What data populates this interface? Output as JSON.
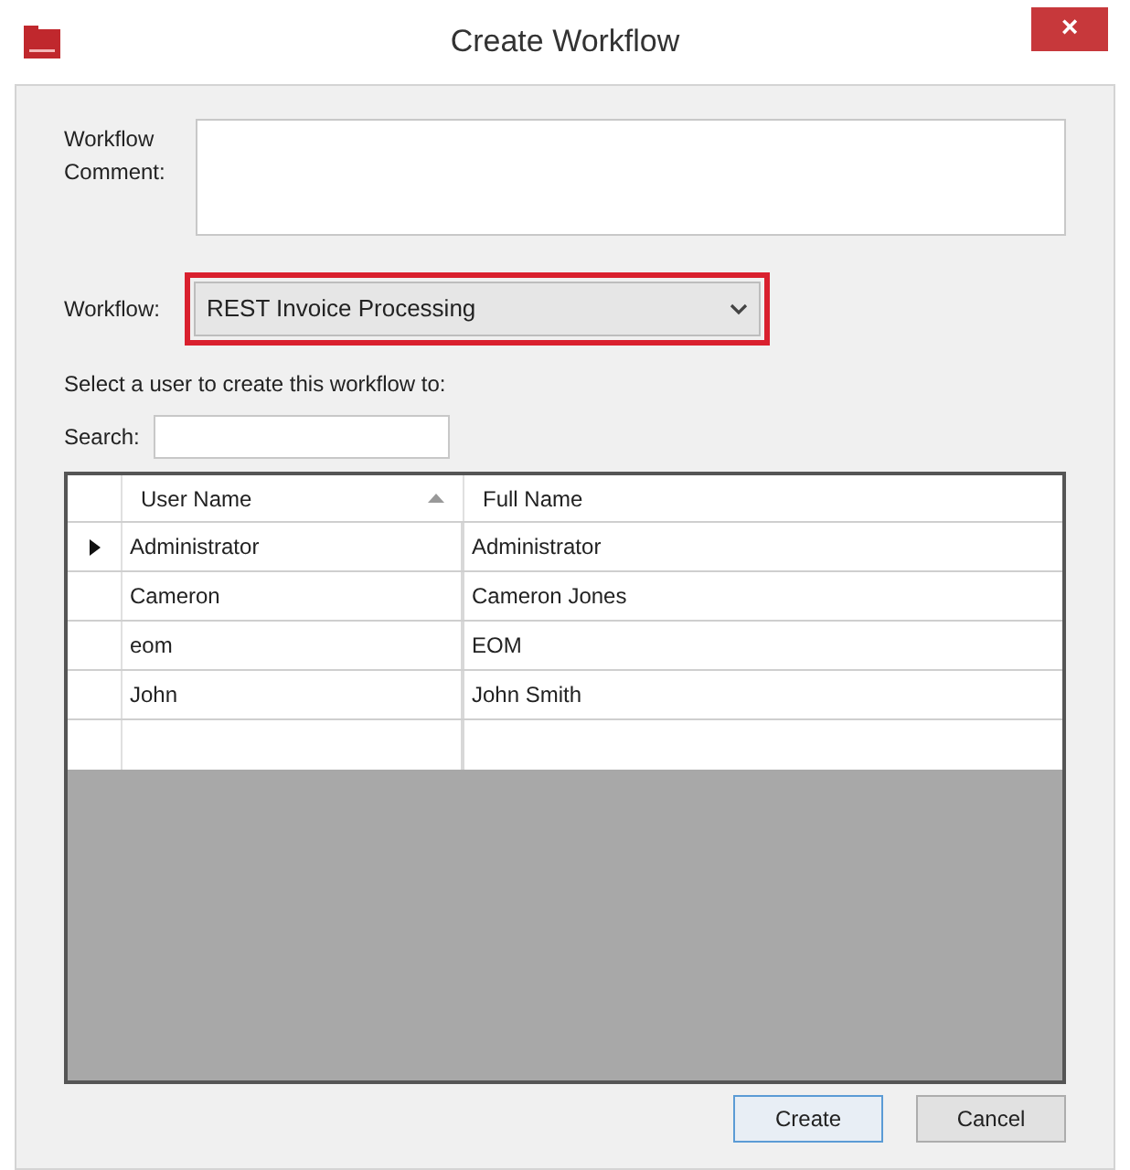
{
  "window": {
    "title": "Create Workflow",
    "close": "×"
  },
  "comment": {
    "label": "Workflow Comment:"
  },
  "workflow": {
    "label": "Workflow:",
    "value": "REST Invoice Processing",
    "highlighted": true
  },
  "instruction": "Select a user to create this workflow to:",
  "search": {
    "label": "Search:"
  },
  "table": {
    "columns": [
      {
        "label": "User Name",
        "sorted": true
      },
      {
        "label": "Full Name",
        "sorted": false
      }
    ],
    "rows": [
      {
        "selected": true,
        "cells": [
          "Administrator",
          "Administrator"
        ]
      },
      {
        "selected": false,
        "cells": [
          "Cameron",
          "Cameron Jones"
        ]
      },
      {
        "selected": false,
        "cells": [
          "eom",
          "EOM"
        ]
      },
      {
        "selected": false,
        "cells": [
          "John",
          "John Smith"
        ]
      }
    ]
  },
  "buttons": [
    {
      "label": "Create",
      "default": true
    },
    {
      "label": "Cancel",
      "default": false
    }
  ]
}
